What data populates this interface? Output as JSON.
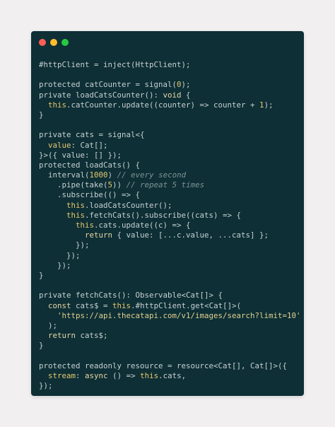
{
  "colors": {
    "page_background": "#f1eff0",
    "editor_background": "#0d2f35",
    "close_dot": "#ff5f57",
    "minimize_dot": "#febc2e",
    "maximize_dot": "#28c840"
  },
  "window_controls": [
    {
      "name": "close-dot",
      "color": "#ff5f57"
    },
    {
      "name": "minimize-dot",
      "color": "#febc2e"
    },
    {
      "name": "maximize-dot",
      "color": "#28c840"
    }
  ],
  "code": {
    "lines": [
      [
        {
          "t": "#httpClient = inject(HttpClient);",
          "k": "text"
        }
      ],
      [],
      [
        {
          "t": "protected ",
          "k": "text"
        },
        {
          "t": "catCounter = signal(",
          "k": "text"
        },
        {
          "t": "0",
          "k": "num"
        },
        {
          "t": ");",
          "k": "text"
        }
      ],
      [
        {
          "t": "private ",
          "k": "text"
        },
        {
          "t": "loadCatsCounter(): ",
          "k": "text"
        },
        {
          "t": "void",
          "k": "kw"
        },
        {
          "t": " {",
          "k": "text"
        }
      ],
      [
        {
          "t": "  ",
          "k": "text"
        },
        {
          "t": "this",
          "k": "this"
        },
        {
          "t": ".catCounter.update((counter) => counter + ",
          "k": "text"
        },
        {
          "t": "1",
          "k": "num"
        },
        {
          "t": ");",
          "k": "text"
        }
      ],
      [
        {
          "t": "}",
          "k": "text"
        }
      ],
      [],
      [
        {
          "t": "private ",
          "k": "text"
        },
        {
          "t": "cats = signal<{",
          "k": "text"
        }
      ],
      [
        {
          "t": "  ",
          "k": "text"
        },
        {
          "t": "value",
          "k": "acc"
        },
        {
          "t": ": Cat[];",
          "k": "text"
        }
      ],
      [
        {
          "t": "}>({ value: [] });",
          "k": "text"
        }
      ],
      [
        {
          "t": "protected ",
          "k": "text"
        },
        {
          "t": "loadCats() {",
          "k": "text"
        }
      ],
      [
        {
          "t": "  ",
          "k": "text"
        },
        {
          "t": "interval(",
          "k": "text"
        },
        {
          "t": "1000",
          "k": "num"
        },
        {
          "t": ") ",
          "k": "text"
        },
        {
          "t": "// every second",
          "k": "com"
        }
      ],
      [
        {
          "t": "    ",
          "k": "text"
        },
        {
          "t": ".pipe(take(",
          "k": "text"
        },
        {
          "t": "5",
          "k": "num"
        },
        {
          "t": ")) ",
          "k": "text"
        },
        {
          "t": "// repeat 5 times",
          "k": "com"
        }
      ],
      [
        {
          "t": "    ",
          "k": "text"
        },
        {
          "t": ".subscribe(() => {",
          "k": "text"
        }
      ],
      [
        {
          "t": "      ",
          "k": "text"
        },
        {
          "t": "this",
          "k": "this"
        },
        {
          "t": ".loadCatsCounter();",
          "k": "text"
        }
      ],
      [
        {
          "t": "      ",
          "k": "text"
        },
        {
          "t": "this",
          "k": "this"
        },
        {
          "t": ".fetchCats().subscribe((cats) => {",
          "k": "text"
        }
      ],
      [
        {
          "t": "        ",
          "k": "text"
        },
        {
          "t": "this",
          "k": "this"
        },
        {
          "t": ".cats.update((c) => {",
          "k": "text"
        }
      ],
      [
        {
          "t": "          ",
          "k": "text"
        },
        {
          "t": "return",
          "k": "kw"
        },
        {
          "t": " { value: [...c.value, ...cats] };",
          "k": "text"
        }
      ],
      [
        {
          "t": "        });",
          "k": "text"
        }
      ],
      [
        {
          "t": "      });",
          "k": "text"
        }
      ],
      [
        {
          "t": "    });",
          "k": "text"
        }
      ],
      [
        {
          "t": "}",
          "k": "text"
        }
      ],
      [],
      [
        {
          "t": "private ",
          "k": "text"
        },
        {
          "t": "fetchCats(): Observable<Cat[]> {",
          "k": "text"
        }
      ],
      [
        {
          "t": "  ",
          "k": "text"
        },
        {
          "t": "const",
          "k": "kw"
        },
        {
          "t": " cats$ = ",
          "k": "text"
        },
        {
          "t": "this",
          "k": "this"
        },
        {
          "t": ".#httpClient.get<Cat[]>(",
          "k": "text"
        }
      ],
      [
        {
          "t": "    ",
          "k": "text"
        },
        {
          "t": "'https://api.thecatapi.com/v1/images/search?limit=10'",
          "k": "str"
        }
      ],
      [
        {
          "t": "  );",
          "k": "text"
        }
      ],
      [
        {
          "t": "  ",
          "k": "text"
        },
        {
          "t": "return",
          "k": "kw"
        },
        {
          "t": " cats$;",
          "k": "text"
        }
      ],
      [
        {
          "t": "}",
          "k": "text"
        }
      ],
      [],
      [
        {
          "t": "protected readonly ",
          "k": "text"
        },
        {
          "t": "resource = resource<Cat[], Cat[]>({",
          "k": "text"
        }
      ],
      [
        {
          "t": "  ",
          "k": "text"
        },
        {
          "t": "stream",
          "k": "acc"
        },
        {
          "t": ": ",
          "k": "text"
        },
        {
          "t": "async",
          "k": "kw"
        },
        {
          "t": " () => ",
          "k": "text"
        },
        {
          "t": "this",
          "k": "this"
        },
        {
          "t": ".cats,",
          "k": "text"
        }
      ],
      [
        {
          "t": "});",
          "k": "text"
        }
      ]
    ]
  }
}
